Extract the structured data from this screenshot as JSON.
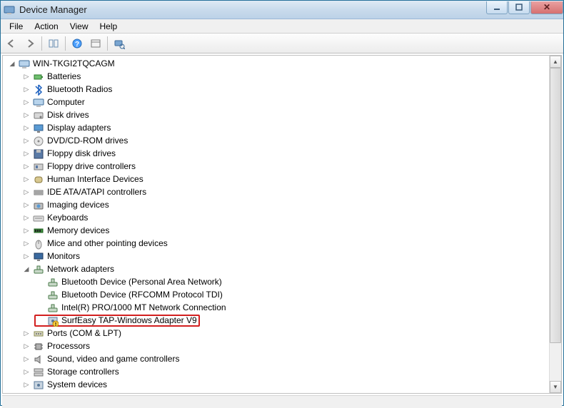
{
  "window": {
    "title": "Device Manager"
  },
  "menu": {
    "file": "File",
    "action": "Action",
    "view": "View",
    "help": "Help"
  },
  "tree": {
    "root": "WIN-TKGI2TQCAGM",
    "categories": [
      {
        "label": "Batteries",
        "icon": "battery-icon"
      },
      {
        "label": "Bluetooth Radios",
        "icon": "bluetooth-icon"
      },
      {
        "label": "Computer",
        "icon": "computer-icon"
      },
      {
        "label": "Disk drives",
        "icon": "disk-icon"
      },
      {
        "label": "Display adapters",
        "icon": "display-icon"
      },
      {
        "label": "DVD/CD-ROM drives",
        "icon": "cdrom-icon"
      },
      {
        "label": "Floppy disk drives",
        "icon": "floppy-icon"
      },
      {
        "label": "Floppy drive controllers",
        "icon": "floppy-ctrl-icon"
      },
      {
        "label": "Human Interface Devices",
        "icon": "hid-icon"
      },
      {
        "label": "IDE ATA/ATAPI controllers",
        "icon": "ide-icon"
      },
      {
        "label": "Imaging devices",
        "icon": "imaging-icon"
      },
      {
        "label": "Keyboards",
        "icon": "keyboard-icon"
      },
      {
        "label": "Memory devices",
        "icon": "memory-icon"
      },
      {
        "label": "Mice and other pointing devices",
        "icon": "mouse-icon"
      },
      {
        "label": "Monitors",
        "icon": "monitor-icon"
      }
    ],
    "network": {
      "label": "Network adapters",
      "icon": "network-icon",
      "children": [
        {
          "label": "Bluetooth Device (Personal Area Network)",
          "icon": "network-icon"
        },
        {
          "label": "Bluetooth Device (RFCOMM Protocol TDI)",
          "icon": "network-icon"
        },
        {
          "label": "Intel(R) PRO/1000 MT Network Connection",
          "icon": "network-icon"
        },
        {
          "label": "SurfEasy TAP-Windows Adapter V9",
          "icon": "network-warn-icon",
          "highlight": true
        }
      ]
    },
    "after": [
      {
        "label": "Ports (COM & LPT)",
        "icon": "port-icon"
      },
      {
        "label": "Processors",
        "icon": "cpu-icon"
      },
      {
        "label": "Sound, video and game controllers",
        "icon": "sound-icon"
      },
      {
        "label": "Storage controllers",
        "icon": "storage-icon"
      },
      {
        "label": "System devices",
        "icon": "system-icon"
      }
    ]
  }
}
